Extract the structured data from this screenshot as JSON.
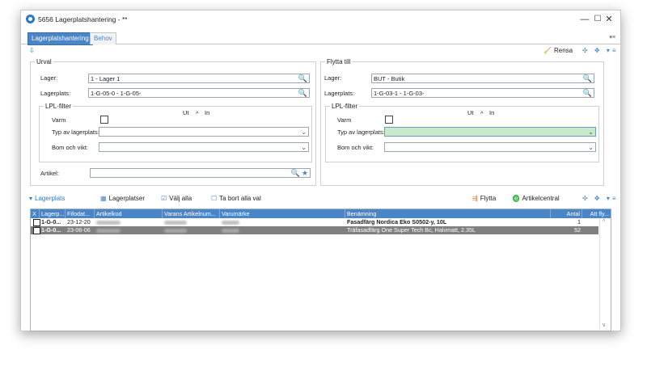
{
  "window": {
    "title": "5656 Lagerplatshantering - **",
    "minimize": "—",
    "maximize": "☐",
    "close": "✕"
  },
  "tabs": [
    {
      "label": "Lagerplatshantering",
      "active": true
    },
    {
      "label": "Behov",
      "active": false
    }
  ],
  "toolbar": {
    "rensa_label": "Rensa"
  },
  "urval": {
    "title": "Urval",
    "lager_label": "Lager:",
    "lager_value": "1 - Lager 1",
    "lagerplats_label": "Lagerplats:",
    "lagerplats_value": "1-G-05-0 - 1-G-05-",
    "lpl_title": "LPL-filter",
    "ut_label": "Ut",
    "arrow": "^",
    "in_label": "In",
    "varm_label": "Varm",
    "typ_label": "Typ av lagerplats:",
    "typ_value": "",
    "bom_label": "Bom och vikt:",
    "bom_value": "",
    "artikel_label": "Artikel:",
    "artikel_value": ""
  },
  "flytta": {
    "title": "Flytta till",
    "lager_label": "Lager:",
    "lager_value": "BUT - Butik",
    "lagerplats_label": "Lagerplats:",
    "lagerplats_value": "1-G-03-1 - 1-G-03-",
    "lpl_title": "LPL-filter",
    "ut_label": "Ut",
    "arrow": "^",
    "in_label": "In",
    "varm_label": "Varm",
    "typ_label": "Typ av lagerplats:",
    "typ_value": "",
    "bom_label": "Bom och vikt:",
    "bom_value": ""
  },
  "grid_toolbar": {
    "section_label": "Lagerplats",
    "lagerplatser": "Lagerplatser",
    "valj_alla": "Välj alla",
    "ta_bort": "Ta bort alla val",
    "flytta": "Flytta",
    "artikelcentral": "Artikelcentral"
  },
  "grid": {
    "columns": [
      "X",
      "Lagerp...",
      "Fifodat...",
      "Artikelkod",
      "Varans Artikelnum...",
      "Varumärke",
      "Benämning",
      "Antal",
      "Att fly..."
    ],
    "rows": [
      {
        "lagerplats": "1-G-0...",
        "fifodatum": "23-12-20",
        "benamning": "Fasadfärg Nordica Eko S0502-y, 10L",
        "antal": "1",
        "selected": false
      },
      {
        "lagerplats": "1-G-0...",
        "fifodatum": "23-06-06",
        "benamning": "Träfasadfärg One Super Tech Bc, Halvmatt, 2.35L",
        "antal": "52",
        "selected": true
      }
    ]
  },
  "colors": {
    "accent": "#4a86c7",
    "selected_row": "#808080",
    "active_field": "#c8eacb"
  }
}
